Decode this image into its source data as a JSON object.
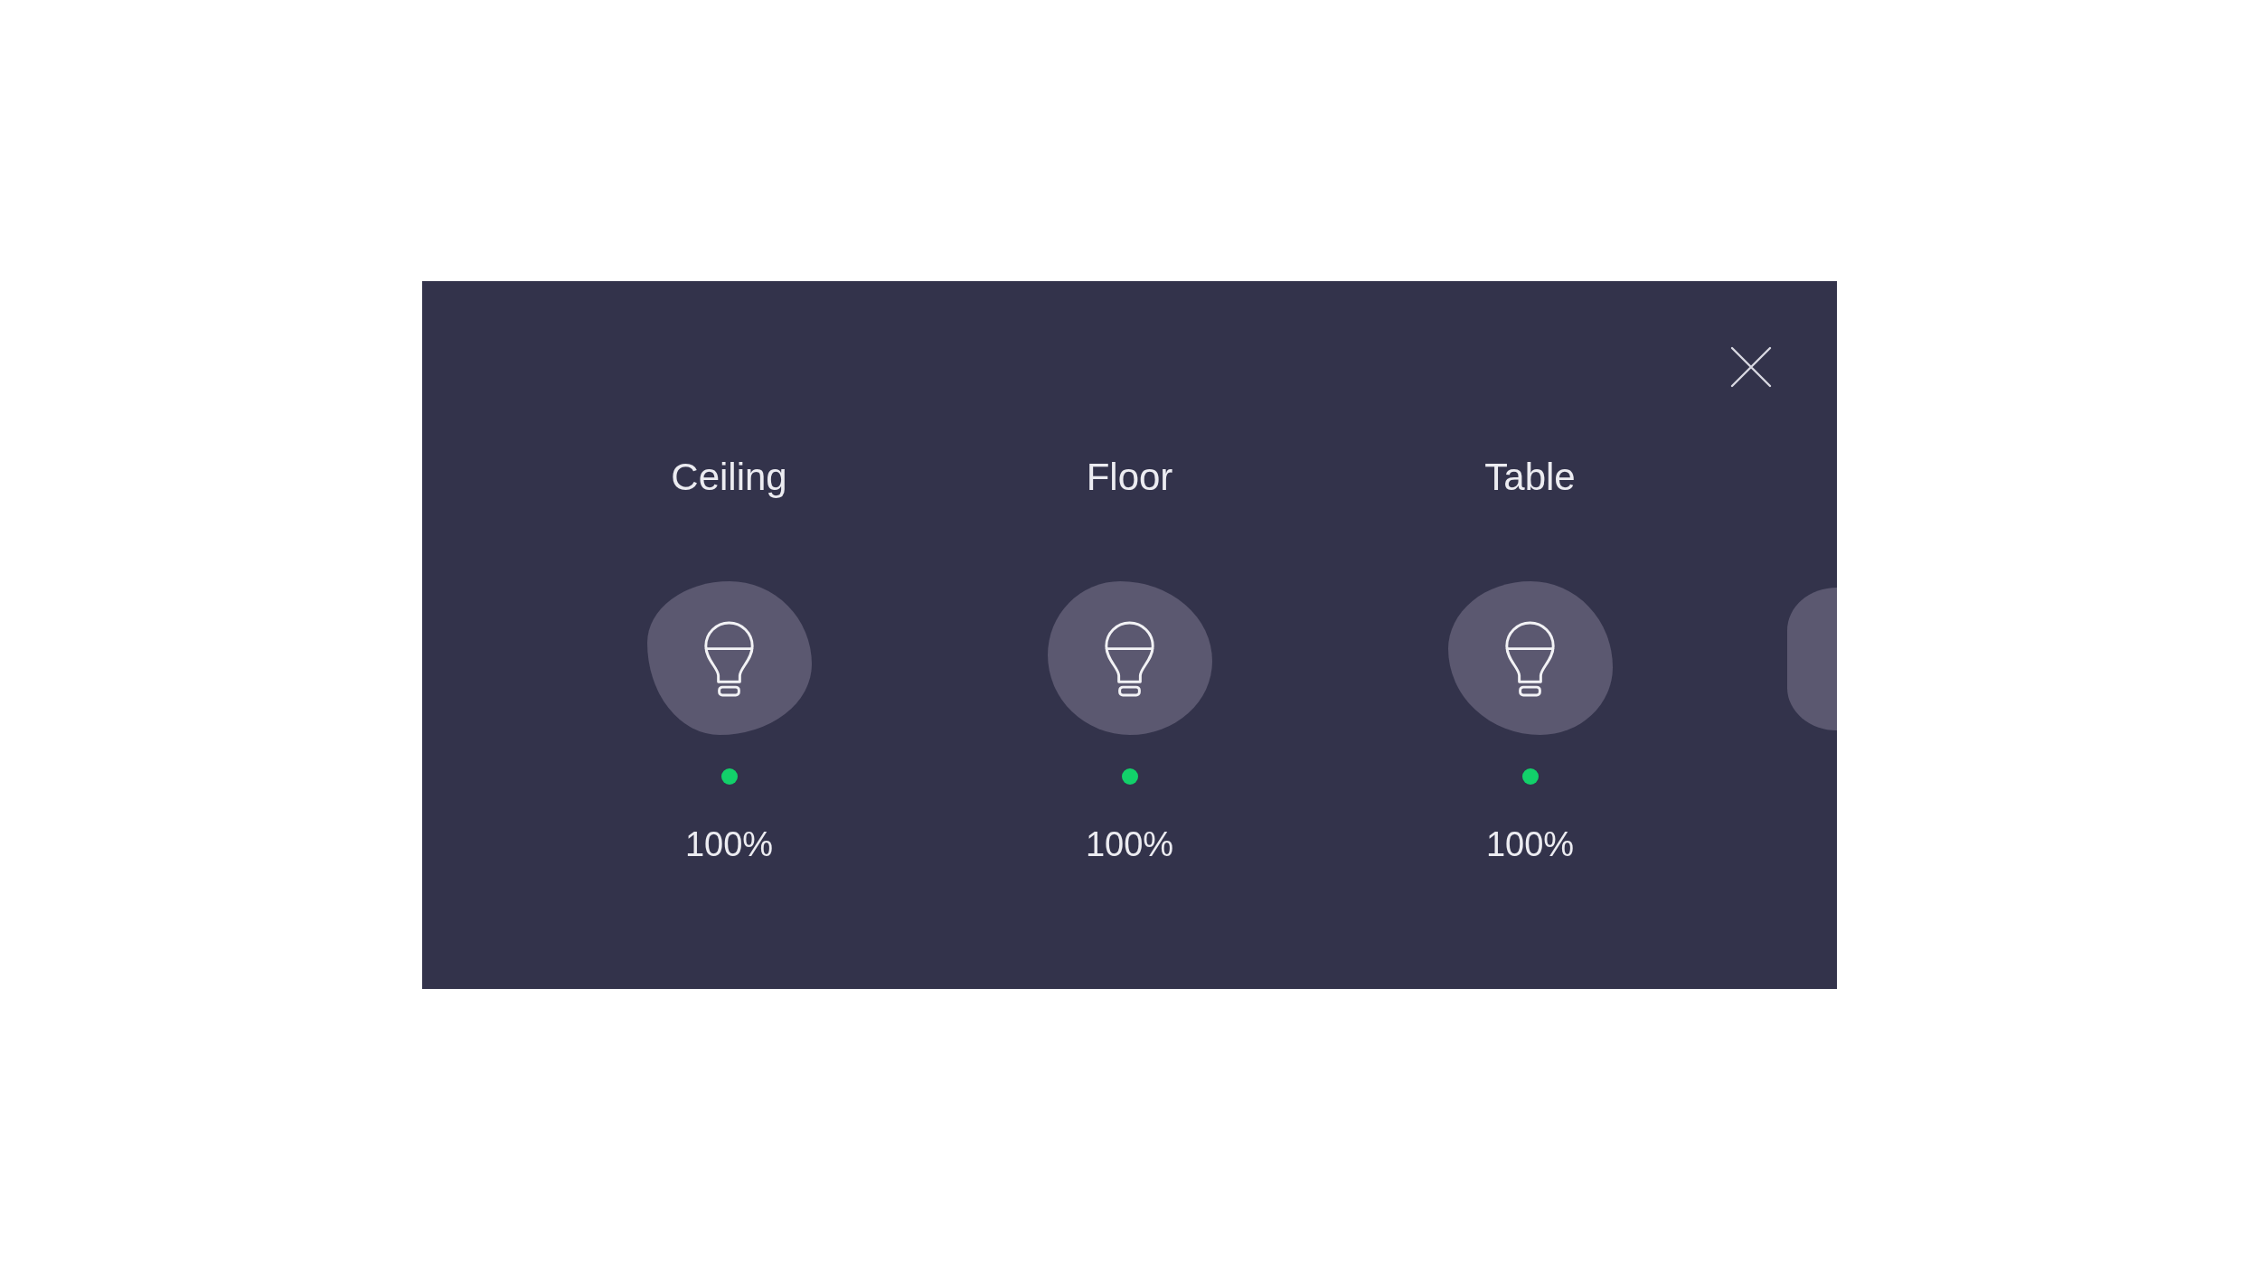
{
  "lights": [
    {
      "name": "Ceiling",
      "on": true,
      "brightness": "100%"
    },
    {
      "name": "Floor",
      "on": true,
      "brightness": "100%"
    },
    {
      "name": "Table",
      "on": true,
      "brightness": "100%"
    }
  ]
}
